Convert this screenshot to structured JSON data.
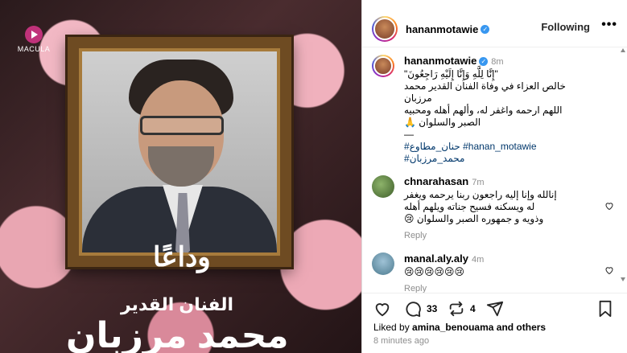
{
  "media": {
    "brand_name": "MACULA",
    "farewell": "وداعًا",
    "subtitle": "الفنان القدير",
    "name": "محمد مرزبان"
  },
  "header": {
    "username": "hananmotawie",
    "follow_label": "Following",
    "more": "•••"
  },
  "caption": {
    "username": "hananmotawie",
    "time": "8m",
    "lines": [
      "\"إِنَّا لِلَّهِ وَإِنَّا إِلَيْهِ رَاجِعُونَ\"",
      "خالص العزاء في وفاة الفنان القدير محمد",
      "مرزبان",
      "اللهم ارحمه واغفر له، وألهم أهله ومحبيه",
      "الصبر والسلوان 🙏",
      "—"
    ],
    "tags_line1": "#حنان_مطاوع #hanan_motawie",
    "tags_line2": "#محمد_مرزبان"
  },
  "comments": [
    {
      "username": "chnarahasan",
      "time": "7m",
      "lines": [
        "إنالله وإنا إليه راجعون ربنا يرحمه ويغفر",
        "له ويسكنه فسيح جناته ويلهم أهله",
        "وذويه و جمهوره الصبر والسلوان 😢"
      ],
      "reply": "Reply"
    },
    {
      "username": "manal.aly.aly",
      "time": "4m",
      "lines": [
        "😢😢😢😢😢😢"
      ],
      "reply": "Reply"
    }
  ],
  "actions": {
    "comments_count": "33",
    "reposts_count": "4"
  },
  "likes": {
    "prefix": "Liked by",
    "user": "amina_benouama",
    "suffix": "and others"
  },
  "timestamp": "8 minutes ago",
  "colors": {
    "link": "#00376b",
    "muted": "#8e8e8e",
    "verified": "#3897f0"
  }
}
